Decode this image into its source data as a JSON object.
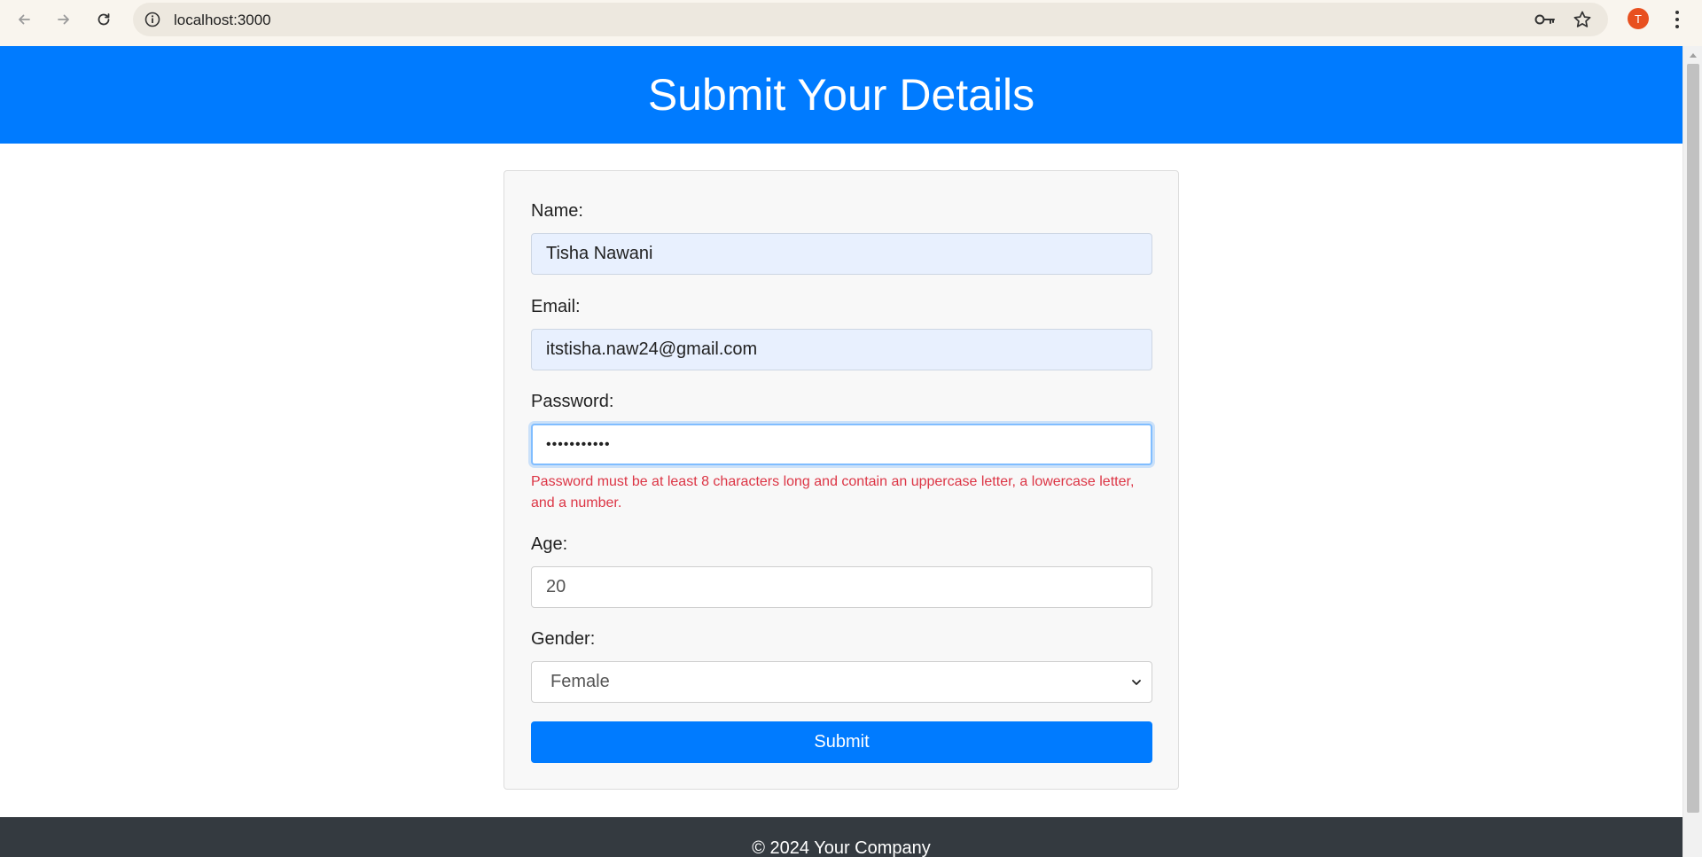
{
  "browser": {
    "url": "localhost:3000",
    "profile_initial": "T",
    "icons": [
      "back-arrow-icon",
      "forward-arrow-icon",
      "reload-icon",
      "info-icon",
      "key-icon",
      "star-icon",
      "kebab-menu-icon"
    ]
  },
  "header": {
    "title": "Submit Your Details"
  },
  "form": {
    "name_label": "Name:",
    "name_value": "Tisha Nawani",
    "email_label": "Email:",
    "email_value": "itstisha.naw24@gmail.com",
    "password_label": "Password:",
    "password_value": "•••••••••••",
    "password_error": "Password must be at least 8 characters long and contain an uppercase letter, a lowercase letter, and a number.",
    "age_label": "Age:",
    "age_value": "20",
    "gender_label": "Gender:",
    "gender_value": "Female",
    "submit_label": "Submit"
  },
  "footer": {
    "text": "© 2024 Your Company"
  },
  "colors": {
    "primary": "#007bff",
    "error": "#dc3545",
    "footer_bg": "#343a40",
    "autofill_bg": "#e8f0fe"
  }
}
